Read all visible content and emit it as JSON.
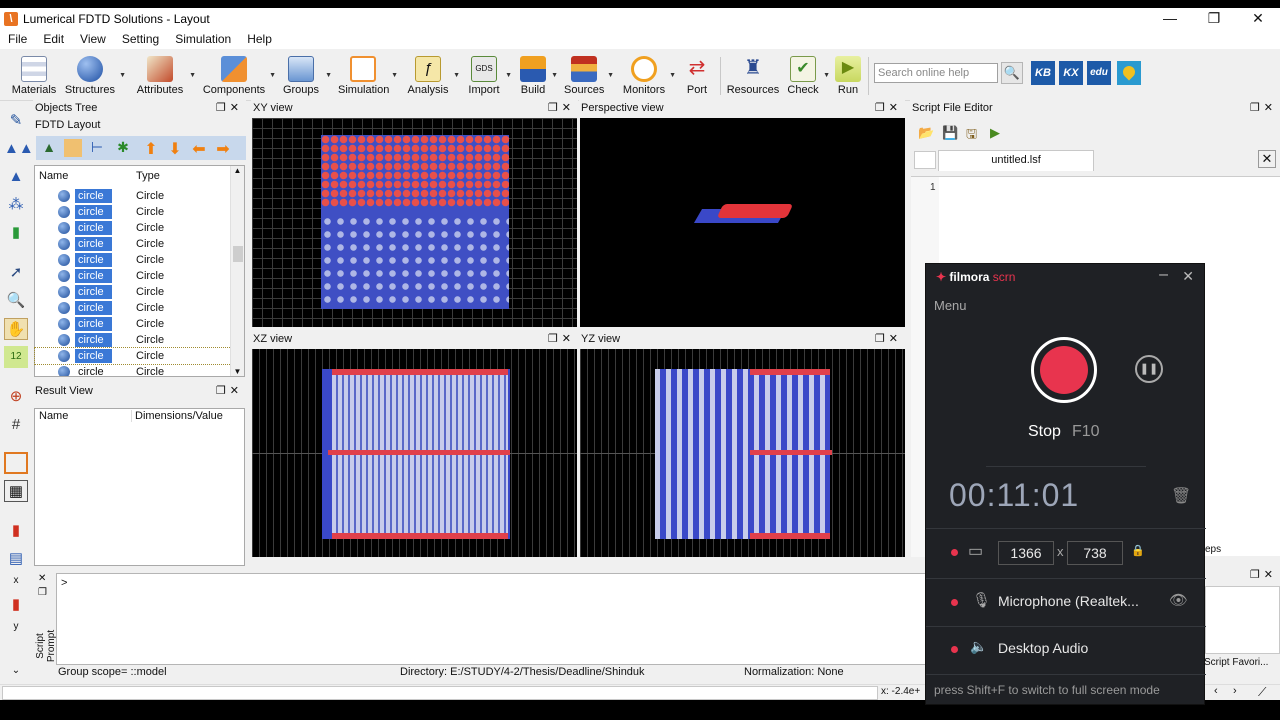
{
  "window": {
    "title": "Lumerical FDTD Solutions - Layout",
    "controls": [
      "—",
      "❐",
      "✕"
    ]
  },
  "menu": [
    "File",
    "Edit",
    "View",
    "Setting",
    "Simulation",
    "Help"
  ],
  "toolbar": {
    "buttons": [
      "Materials",
      "Structures",
      "Attributes",
      "Components",
      "Groups",
      "Simulation",
      "Analysis",
      "Import",
      "Build",
      "Sources",
      "Monitors",
      "Port",
      "Resources",
      "Check",
      "Run"
    ],
    "search_placeholder": "Search online help",
    "badges": [
      "KB",
      "KX",
      "edu"
    ]
  },
  "objects_tree": {
    "title": "Objects Tree",
    "subtitle": "FDTD Layout",
    "col_name": "Name",
    "col_type": "Type",
    "rows": [
      {
        "name": "circle",
        "type": "Circle"
      },
      {
        "name": "circle",
        "type": "Circle"
      },
      {
        "name": "circle",
        "type": "Circle"
      },
      {
        "name": "circle",
        "type": "Circle"
      },
      {
        "name": "circle",
        "type": "Circle"
      },
      {
        "name": "circle",
        "type": "Circle"
      },
      {
        "name": "circle",
        "type": "Circle"
      },
      {
        "name": "circle",
        "type": "Circle"
      },
      {
        "name": "circle",
        "type": "Circle"
      },
      {
        "name": "circle",
        "type": "Circle"
      },
      {
        "name": "circle",
        "type": "Circle"
      },
      {
        "name": "circle",
        "type": "Circle"
      }
    ]
  },
  "result_view": {
    "title": "Result View",
    "col_name": "Name",
    "col_value": "Dimensions/Value"
  },
  "views": {
    "xy": "XY view",
    "perspective": "Perspective view",
    "xz": "XZ view",
    "yz": "YZ view"
  },
  "script_editor": {
    "title": "Script File Editor",
    "tab": "untitled.lsf",
    "line_number": "1"
  },
  "script_prompt": {
    "label": "Script Prompt",
    "prompt_symbol": ">",
    "side_labels": [
      "x",
      "y"
    ]
  },
  "statusbar": {
    "scope": "Group scope= ::model",
    "directory": "Directory: E:/STUDY/4-2/Thesis/Deadline/Shinduk",
    "normalization": "Normalization: None",
    "coords": "x: -2.4e+",
    "right_tab1": "eps",
    "right_tab2": "Script Favori..."
  },
  "filmora": {
    "brand": "filmora",
    "brand_suffix": "scrn",
    "menu": "Menu",
    "stop_label": "Stop",
    "stop_key": "F10",
    "timer": "00:11:01",
    "width": "1366",
    "height": "738",
    "times": "x",
    "microphone": "Microphone (Realtek...",
    "desktop_audio": "Desktop Audio",
    "hint": "press Shift+F to switch to full screen mode",
    "accent": "#e8344e"
  }
}
